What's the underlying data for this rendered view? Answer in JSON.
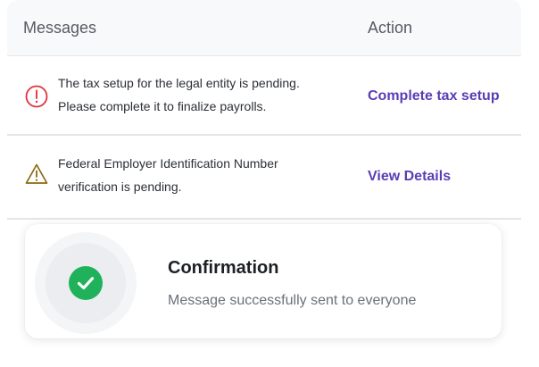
{
  "table": {
    "headers": {
      "messages": "Messages",
      "action": "Action"
    },
    "rows": [
      {
        "icon": "error-circle-icon",
        "message_lines": [
          "The tax setup for the legal entity is pending.",
          "Please complete it to finalize payrolls."
        ],
        "action_label": "Complete tax setup"
      },
      {
        "icon": "warning-triangle-icon",
        "message_lines": [
          "Federal Employer Identification Number",
          "verification is pending."
        ],
        "action_label": "View Details"
      }
    ]
  },
  "toast": {
    "icon": "check-circle-icon",
    "title": "Confirmation",
    "message": "Message successfully sent to everyone"
  },
  "colors": {
    "error": "#e0343c",
    "warning": "#8a6a12",
    "link": "#5a3db5",
    "success": "#1fb25a"
  }
}
